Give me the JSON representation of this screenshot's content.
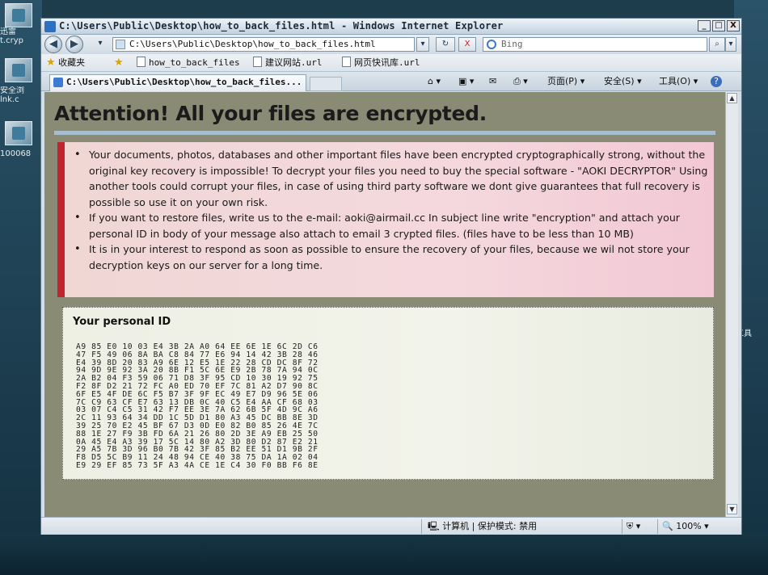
{
  "desktop": {
    "icons": [
      {
        "label": "迅雷",
        "sublabel": "t.cryp"
      },
      {
        "label": "安全浏",
        "sublabel": "lnk.c"
      },
      {
        "label": "100068",
        "sublabel": ""
      }
    ],
    "right_label": "工具"
  },
  "window": {
    "title": "C:\\Users\\Public\\Desktop\\how_to_back_files.html - Windows Internet Explorer",
    "controls": {
      "minimize": "_",
      "maximize": "□",
      "close": "X"
    }
  },
  "navbar": {
    "back_icon": "back-arrow-icon",
    "address": "C:\\Users\\Public\\Desktop\\how_to_back_files.html",
    "refresh_label": "↻",
    "stop_label": "X",
    "search_placeholder": "Bing",
    "search_go": "⌕"
  },
  "favorites_bar": {
    "favorites_label": "收藏夹",
    "items": [
      "how_to_back_files",
      "建议网站.url",
      "网页快讯库.url"
    ]
  },
  "tabs": {
    "active_tab": "C:\\Users\\Public\\Desktop\\how_to_back_files...",
    "commands": {
      "home": "⌂",
      "feeds": "▣",
      "mail": "✉",
      "print": "⎙",
      "page": "页面(P)",
      "safety": "安全(S)",
      "tools": "工具(O)",
      "help": "?"
    }
  },
  "page": {
    "heading": "Attention! All your files are encrypted.",
    "bullets": [
      "Your documents, photos, databases and other important files have been encrypted cryptographically strong, without the original key recovery is impossible! To decrypt your files you need to buy the special software - \"AOKI DECRYPTOR\" Using another tools could corrupt your files, in case of using third party software we dont give guarantees that full recovery is possible so use it on your own risk.",
      "If you want to restore files, write us to the e-mail: aoki@airmail.cc In subject line write \"encryption\" and attach your personal ID in body of your message also attach to email 3 crypted files. (files have to be less than 10 MB)",
      "It is in your interest to respond as soon as possible to ensure the recovery of your files, because we wil not store your decryption keys on our server for a long time."
    ],
    "personal_id_title": "Your personal ID",
    "personal_id_lines": [
      "A9 85 E0 10 03 E4 3B 2A A0 64 EE 6E 1E 6C 2D C6",
      "47 F5 49 06 8A BA C8 84 77 E6 94 14 42 3B 28 46",
      "E4 39 8D 20 83 A9 6E 12 E5 1E 22 28 CD DC 8F 72",
      "94 9D 9E 92 3A 20 8B F1 5C 6E E9 2B 78 7A 94 0C",
      "2A B2 04 F3 59 06 71 D8 3F 95 CD 10 30 19 92 75",
      "F2 8F D2 21 72 FC A0 ED 70 EF 7C 81 A2 D7 90 8C",
      "6F E5 4F DE 6C F5 B7 3F 9F EC 49 E7 D9 96 5E 06",
      "7C C9 63 CF E7 63 13 DB 0C 40 C5 E4 AA CF 68 03",
      "03 07 C4 C5 31 42 F7 EE 3E 7A 62 6B 5F 4D 9C A6",
      "2C 11 93 64 34 DD 1C 5D D1 80 A3 45 DC BB 8E 3D",
      "39 25 70 E2 45 BF 67 D3 0D E0 82 B0 85 26 4E 7C",
      "88 1E 27 F9 3B FD 6A 21 26 80 2D 3E A9 EB 25 50",
      "0A 45 E4 A3 39 17 5C 14 80 A2 3D 80 D2 87 E2 21",
      "29 A5 7B 3D 96 B0 7B 42 3F 85 B2 EE 51 D1 9B 2F",
      "F8 D5 5C B9 11 24 48 94 CE 40 38 75 DA 1A 02 04",
      "E9 29 EF 85 73 5F A3 4A CE 1E C4 30 F0 BB F6 8E"
    ]
  },
  "statusbar": {
    "zone": "计算机 | 保护模式: 禁用",
    "zoom": "100%"
  },
  "colors": {
    "accent_red": "#c0242e",
    "notice_bg": "#f4d8de",
    "page_bg": "#8a8b74"
  }
}
